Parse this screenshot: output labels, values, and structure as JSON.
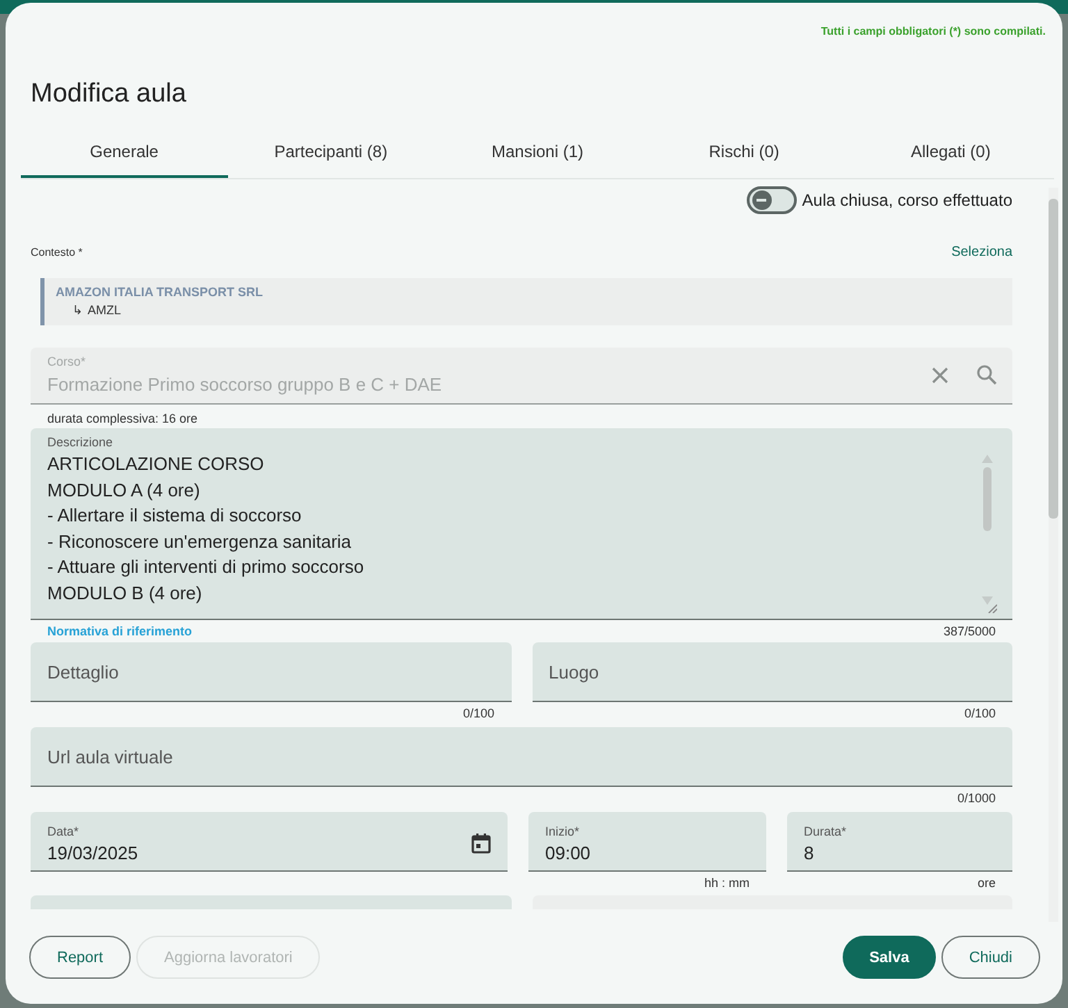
{
  "notice": "Tutti i campi obbligatori (*) sono compilati.",
  "title": "Modifica aula",
  "tabs": [
    {
      "label": "Generale",
      "selected": true
    },
    {
      "label": "Partecipanti (8)",
      "selected": false
    },
    {
      "label": "Mansioni (1)",
      "selected": false
    },
    {
      "label": "Rischi (0)",
      "selected": false
    },
    {
      "label": "Allegati (0)",
      "selected": false
    }
  ],
  "switch": {
    "label": "Aula chiusa, corso effettuato",
    "on": false
  },
  "context": {
    "label": "Contesto *",
    "action": "Seleziona",
    "company": "AMAZON ITALIA TRANSPORT SRL",
    "branch_arrow": "↳",
    "branch": "AMZL"
  },
  "course": {
    "label": "Corso*",
    "value": "Formazione Primo soccorso gruppo B e C + DAE",
    "disabled": true,
    "hint": "durata complessiva: 16 ore"
  },
  "description": {
    "label": "Descrizione",
    "lines": [
      "ARTICOLAZIONE CORSO",
      "MODULO A (4 ore)",
      "- Allertare il sistema di soccorso",
      "- Riconoscere un'emergenza sanitaria",
      "- Attuare gli interventi di primo soccorso",
      "MODULO B (4 ore)"
    ],
    "link": "Normativa di riferimento",
    "counter": "387/5000"
  },
  "rows": [
    [
      {
        "placeholder": "Dettaglio",
        "counter": "0/100"
      },
      {
        "placeholder": "Luogo",
        "counter": "0/100"
      }
    ],
    [
      {
        "placeholder": "Url aula virtuale",
        "counter": "0/1000"
      }
    ],
    [
      {
        "kind": "date",
        "label": "Data*",
        "value": "19/03/2025"
      },
      {
        "kind": "text",
        "label": "Inizio*",
        "value": "09:00",
        "hint": "hh : mm"
      },
      {
        "kind": "text",
        "label": "Durata*",
        "value": "8",
        "hint": "ore"
      }
    ]
  ],
  "buttons": [
    {
      "label": "Report",
      "kind": "outline",
      "disabled": false
    },
    {
      "label": "Aggiorna lavoratori",
      "kind": "outline",
      "disabled": true
    },
    {
      "label": "Salva",
      "kind": "primary",
      "disabled": false
    },
    {
      "label": "Chiudi",
      "kind": "outline",
      "disabled": false
    }
  ]
}
